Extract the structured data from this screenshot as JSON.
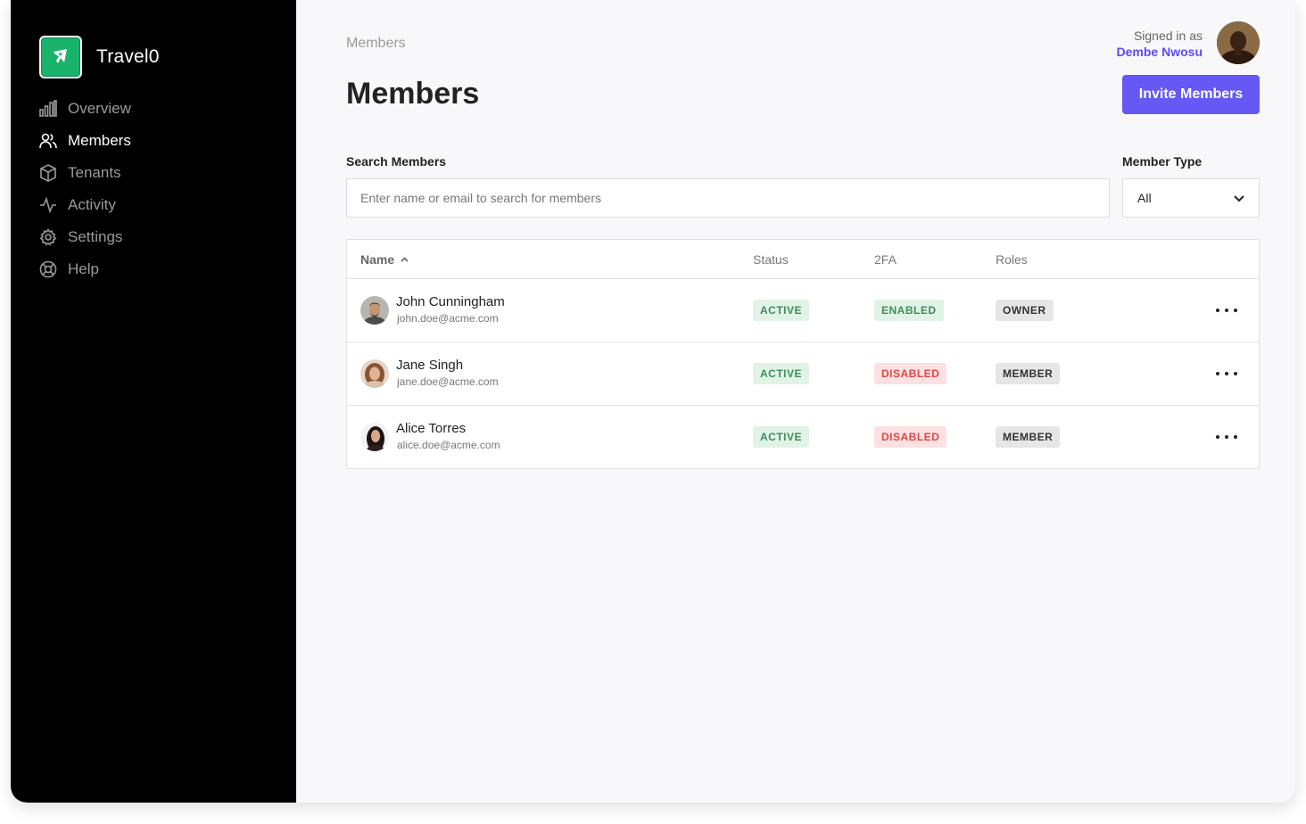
{
  "app": {
    "name": "Travel0"
  },
  "sidebar": {
    "items": [
      {
        "label": "Overview",
        "icon": "bar-chart-icon",
        "active": false
      },
      {
        "label": "Members",
        "icon": "users-icon",
        "active": true
      },
      {
        "label": "Tenants",
        "icon": "cube-icon",
        "active": false
      },
      {
        "label": "Activity",
        "icon": "activity-icon",
        "active": false
      },
      {
        "label": "Settings",
        "icon": "gear-icon",
        "active": false
      },
      {
        "label": "Help",
        "icon": "lifebuoy-icon",
        "active": false
      }
    ]
  },
  "header": {
    "breadcrumb": "Members",
    "title": "Members",
    "signed_in_caption": "Signed in as",
    "signed_in_user": "Dembe Nwosu",
    "invite_label": "Invite Members"
  },
  "filters": {
    "search_label": "Search Members",
    "search_placeholder": "Enter name or email to search for members",
    "search_value": "",
    "type_label": "Member Type",
    "type_value": "All"
  },
  "table": {
    "columns": [
      "Name",
      "Status",
      "2FA",
      "Roles"
    ],
    "rows": [
      {
        "name": "John Cunningham",
        "email": "john.doe@acme.com",
        "status": "ACTIVE",
        "twofa": "ENABLED",
        "role": "OWNER"
      },
      {
        "name": "Jane Singh",
        "email": "jane.doe@acme.com",
        "status": "ACTIVE",
        "twofa": "DISABLED",
        "role": "MEMBER"
      },
      {
        "name": "Alice Torres",
        "email": "alice.doe@acme.com",
        "status": "ACTIVE",
        "twofa": "DISABLED",
        "role": "MEMBER"
      }
    ]
  },
  "colors": {
    "accent": "#6558f5",
    "brand_green": "#19b36b",
    "active_badge": "#e0f3e6",
    "disabled_badge": "#fbe1e1"
  }
}
